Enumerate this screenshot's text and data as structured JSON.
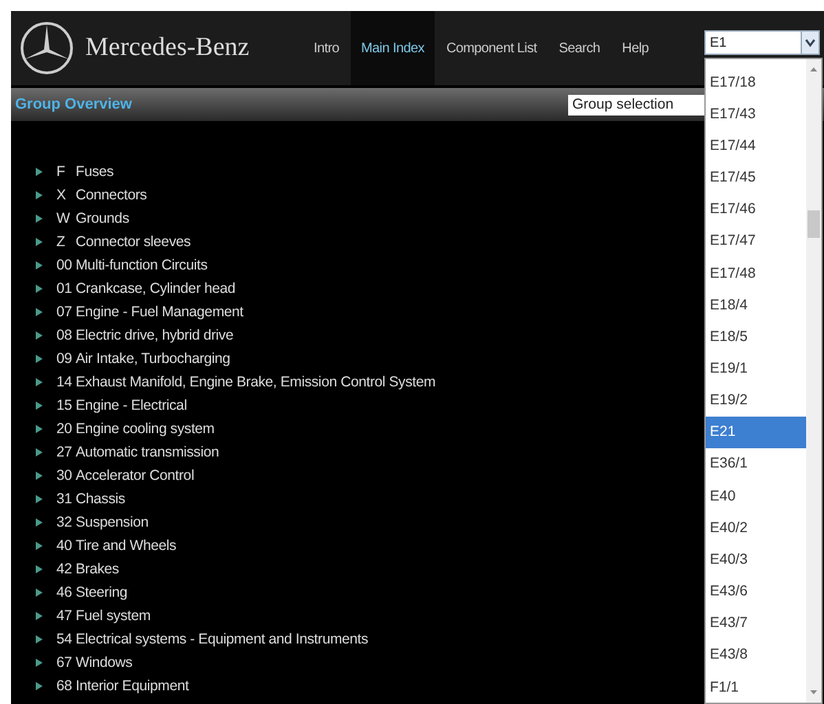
{
  "header": {
    "brand": "Mercedes-Benz",
    "nav": [
      {
        "label": "Intro",
        "selected": false
      },
      {
        "label": "Main Index",
        "selected": true
      },
      {
        "label": "Component List",
        "selected": false
      },
      {
        "label": "Search",
        "selected": false
      },
      {
        "label": "Help",
        "selected": false
      }
    ],
    "component_select": {
      "value": "E1",
      "options": [
        {
          "label": "E17/18",
          "selected": false
        },
        {
          "label": "E17/43",
          "selected": false
        },
        {
          "label": "E17/44",
          "selected": false
        },
        {
          "label": "E17/45",
          "selected": false
        },
        {
          "label": "E17/46",
          "selected": false
        },
        {
          "label": "E17/47",
          "selected": false
        },
        {
          "label": "E17/48",
          "selected": false
        },
        {
          "label": "E18/4",
          "selected": false
        },
        {
          "label": "E18/5",
          "selected": false
        },
        {
          "label": "E19/1",
          "selected": false
        },
        {
          "label": "E19/2",
          "selected": false
        },
        {
          "label": "E21",
          "selected": true
        },
        {
          "label": "E36/1",
          "selected": false
        },
        {
          "label": "E40",
          "selected": false
        },
        {
          "label": "E40/2",
          "selected": false
        },
        {
          "label": "E40/3",
          "selected": false
        },
        {
          "label": "E43/6",
          "selected": false
        },
        {
          "label": "E43/7",
          "selected": false
        },
        {
          "label": "E43/8",
          "selected": false
        },
        {
          "label": "F1/1",
          "selected": false
        }
      ]
    }
  },
  "group_bar": {
    "title": "Group Overview",
    "group_select": {
      "value": "Group selection"
    }
  },
  "groups": [
    {
      "code": "F",
      "name": "Fuses"
    },
    {
      "code": "X",
      "name": "Connectors"
    },
    {
      "code": "W",
      "name": "Grounds"
    },
    {
      "code": "Z",
      "name": "Connector sleeves"
    },
    {
      "code": "00",
      "name": "Multi-function Circuits"
    },
    {
      "code": "01",
      "name": "Crankcase, Cylinder head"
    },
    {
      "code": "07",
      "name": "Engine - Fuel Management"
    },
    {
      "code": "08",
      "name": "Electric drive, hybrid drive"
    },
    {
      "code": "09",
      "name": "Air Intake, Turbocharging"
    },
    {
      "code": "14",
      "name": "Exhaust Manifold, Engine Brake, Emission Control System"
    },
    {
      "code": "15",
      "name": "Engine - Electrical"
    },
    {
      "code": "20",
      "name": "Engine cooling system"
    },
    {
      "code": "27",
      "name": "Automatic transmission"
    },
    {
      "code": "30",
      "name": "Accelerator Control"
    },
    {
      "code": "31",
      "name": "Chassis"
    },
    {
      "code": "32",
      "name": "Suspension"
    },
    {
      "code": "40",
      "name": "Tire and Wheels"
    },
    {
      "code": "42",
      "name": "Brakes"
    },
    {
      "code": "46",
      "name": "Steering"
    },
    {
      "code": "47",
      "name": "Fuel system"
    },
    {
      "code": "54",
      "name": "Electrical systems - Equipment and Instruments"
    },
    {
      "code": "67",
      "name": "Windows"
    },
    {
      "code": "68",
      "name": "Interior Equipment"
    }
  ]
}
